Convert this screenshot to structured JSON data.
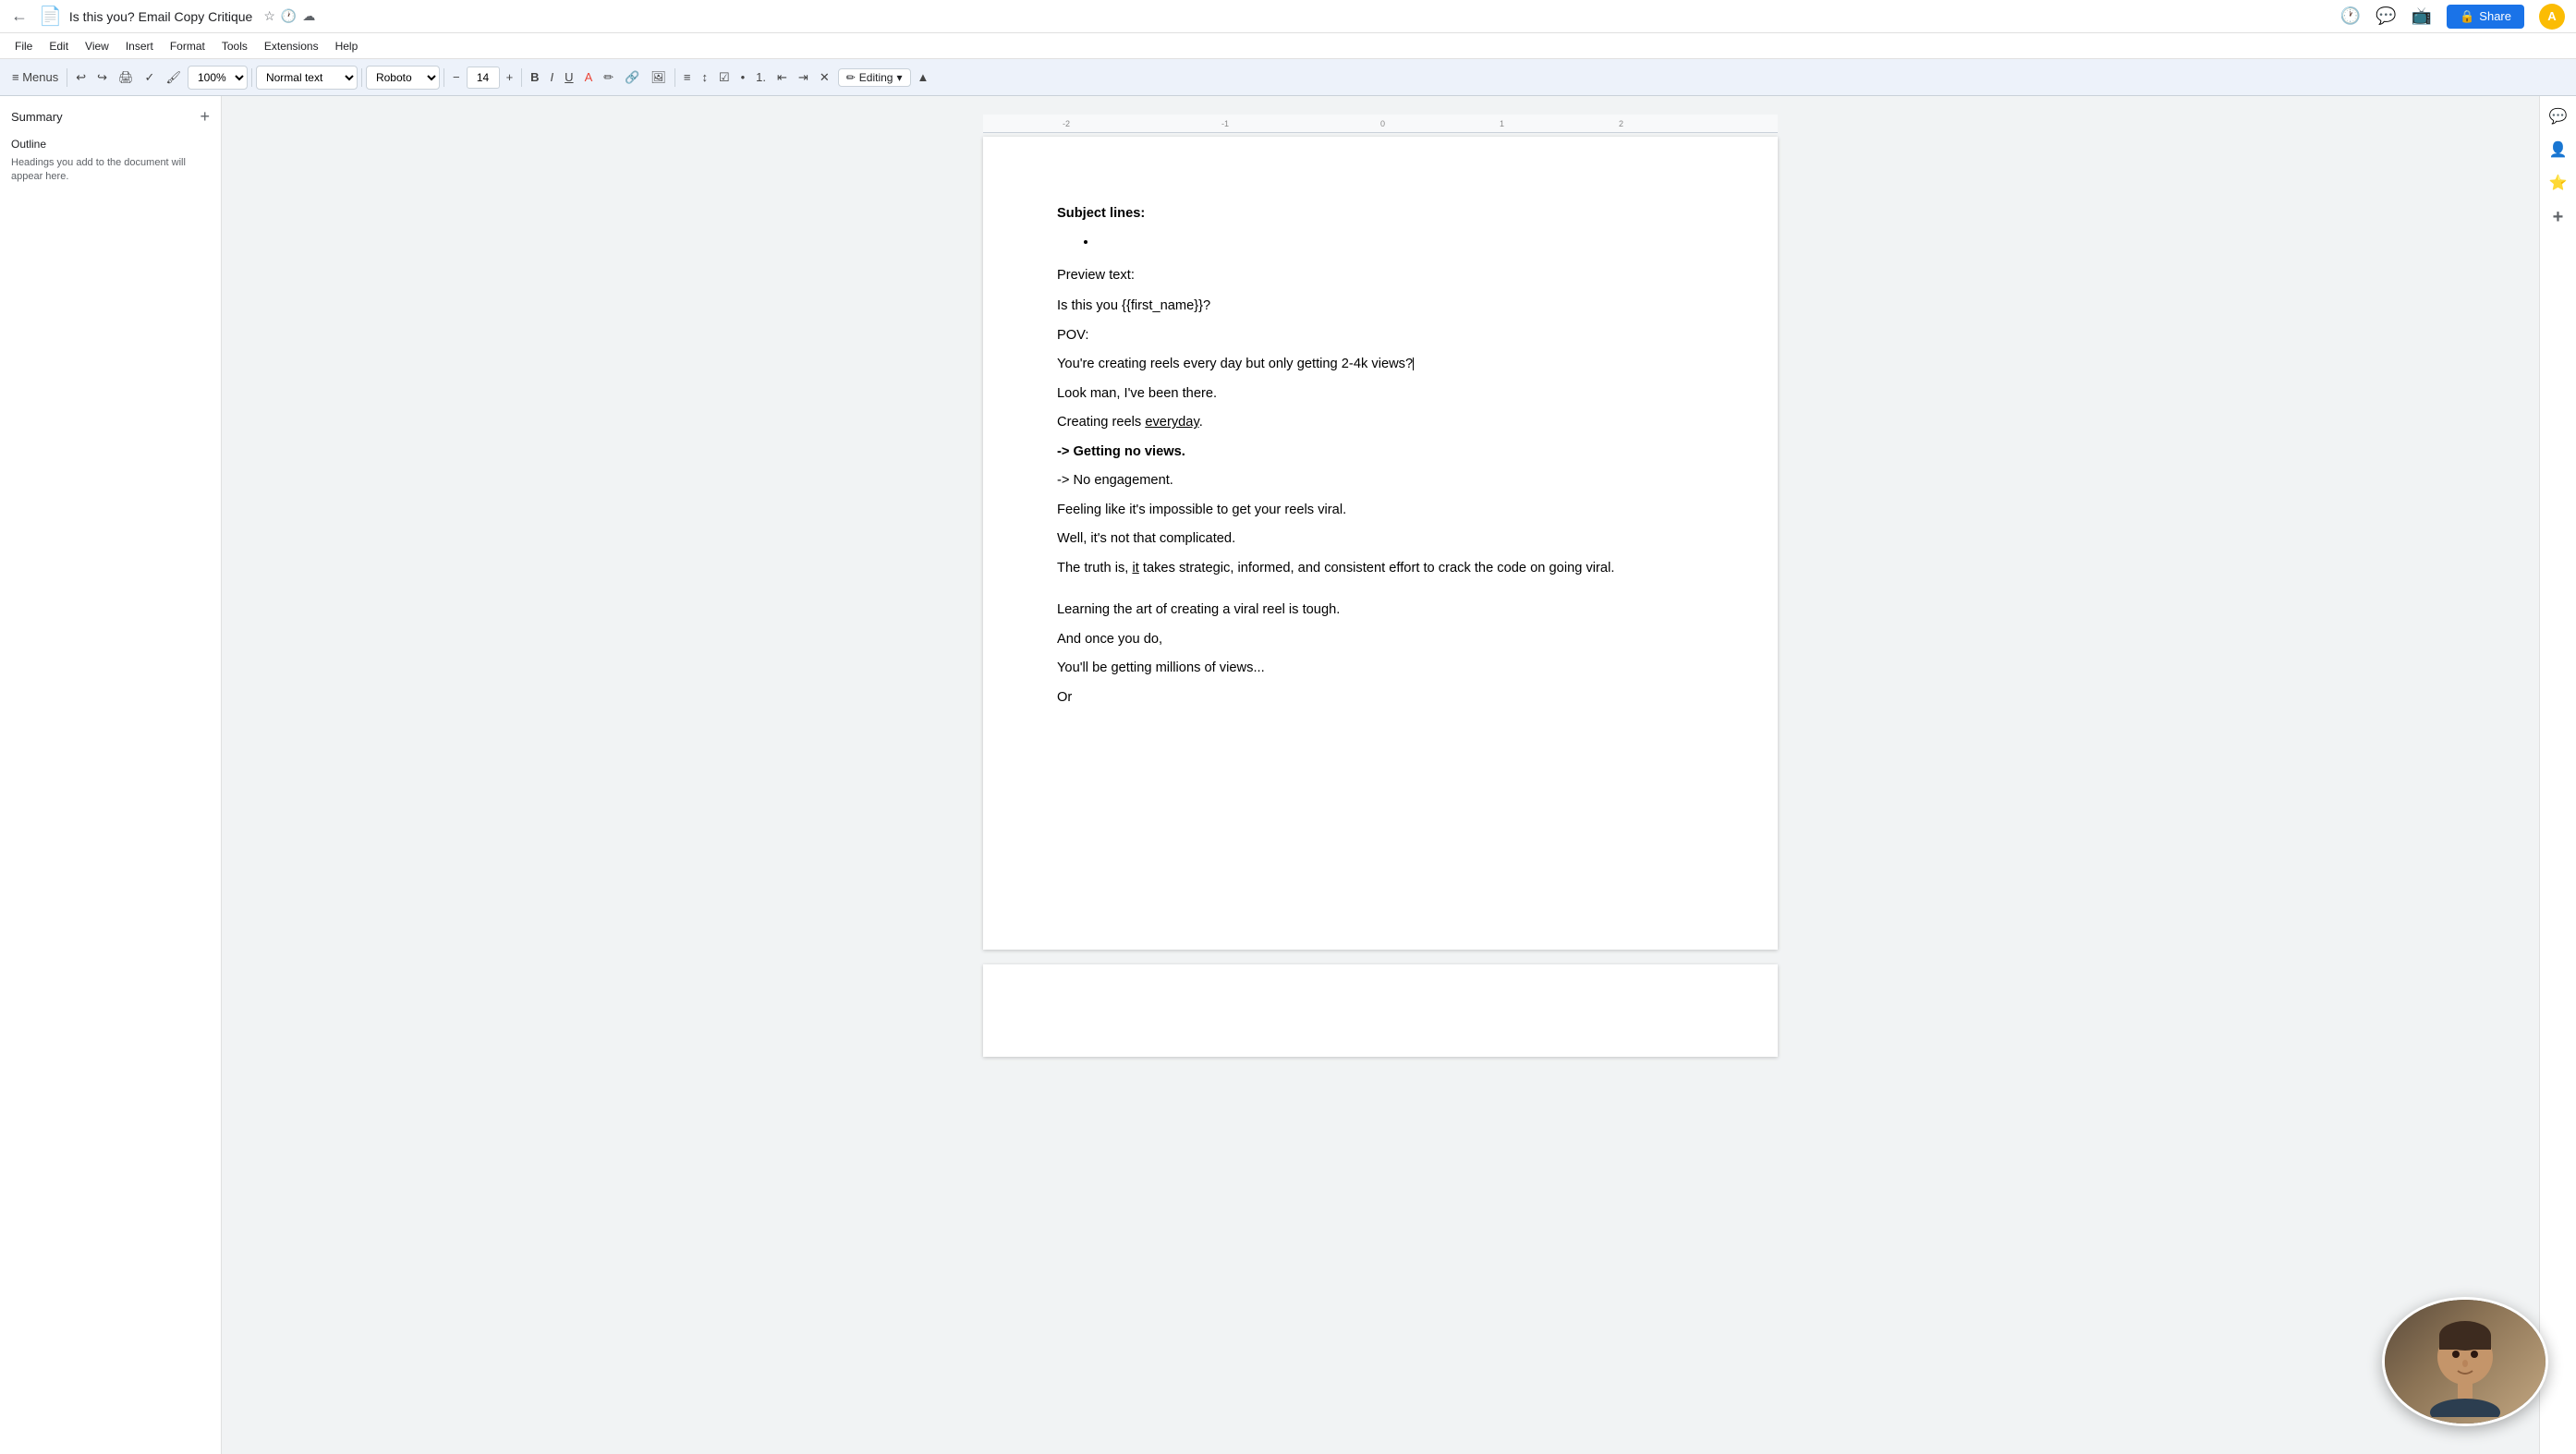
{
  "title_bar": {
    "doc_title": "Is this you? Email Copy Critique",
    "share_label": "Share",
    "avatar_initial": "A"
  },
  "menu_bar": {
    "items": [
      "File",
      "Edit",
      "View",
      "Insert",
      "Format",
      "Tools",
      "Extensions",
      "Help"
    ]
  },
  "toolbar": {
    "zoom": "100%",
    "style": "Normal text",
    "font": "Roboto",
    "font_size": "14",
    "editing_mode": "Editing"
  },
  "sidebar": {
    "summary_label": "Summary",
    "outline_label": "Outline",
    "outline_hint": "Headings you add to the document will appear here."
  },
  "document": {
    "subject_lines_label": "Subject lines:",
    "preview_text_label": "Preview text:",
    "line1": "Is this you {{first_name}}?",
    "line2": "POV:",
    "line3": "You're creating reels every day but only getting 2-4k views?",
    "line4": "Look man, I've been there.",
    "line5": "Creating reels ",
    "line5_underline": "everyday",
    "line5_end": ".",
    "line6": "-> Getting no views.",
    "line7": "-> No engagement.",
    "line8": "Feeling like it's impossible to get your reels viral.",
    "line9": "Well, it's not that complicated.",
    "line10": "The truth is, ",
    "line10_underline": "it",
    "line10_cont": " takes strategic, informed, and consistent effort to crack the code on going viral.",
    "line11": "Learning the art of creating a viral reel is tough.",
    "line12": "And once you do,",
    "line13": "You'll be getting millions of views...",
    "line14": "Or"
  },
  "right_panel": {
    "icons": [
      "chat-icon",
      "person-icon",
      "star-icon",
      "plus-icon"
    ]
  }
}
